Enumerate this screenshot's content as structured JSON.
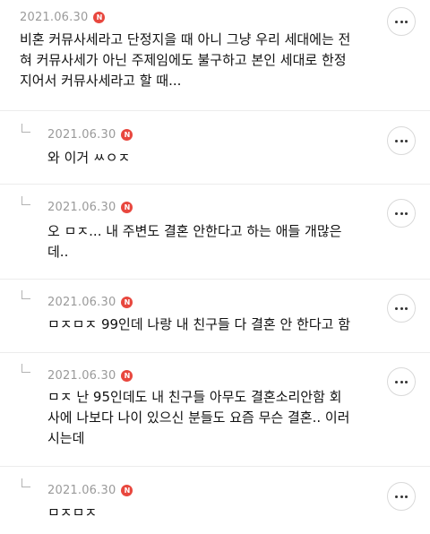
{
  "comments": [
    {
      "date": "2021.06.30",
      "badge": "N",
      "text": "비혼 커뮤사세라고 단정지을 때 아니 그냥 우리 세대에는 전\n혀 커뮤사세가 아닌 주제임에도 불구하고 본인 세대로 한정\n지어서 커뮤사세라고 할 때..."
    },
    {
      "date": "2021.06.30",
      "badge": "N",
      "text": "와 이거 ㅆㅇㅈ"
    },
    {
      "date": "2021.06.30",
      "badge": "N",
      "text": "오 ㅁㅈ... 내 주변도 결혼 안한다고 하는 애들 개많은\n데.."
    },
    {
      "date": "2021.06.30",
      "badge": "N",
      "text": "ㅁㅈㅁㅈ 99인데 나랑 내 친구들 다 결혼 안 한다고 함"
    },
    {
      "date": "2021.06.30",
      "badge": "N",
      "text": "ㅁㅈ 난 95인데도 내 친구들 아무도 결혼소리안함 회\n사에 나보다 나이 있으신 분들도 요즘 무슨 결혼.. 이러\n시는데"
    },
    {
      "date": "2021.06.30",
      "badge": "N",
      "text": "ㅁㅈㅁㅈ"
    }
  ]
}
